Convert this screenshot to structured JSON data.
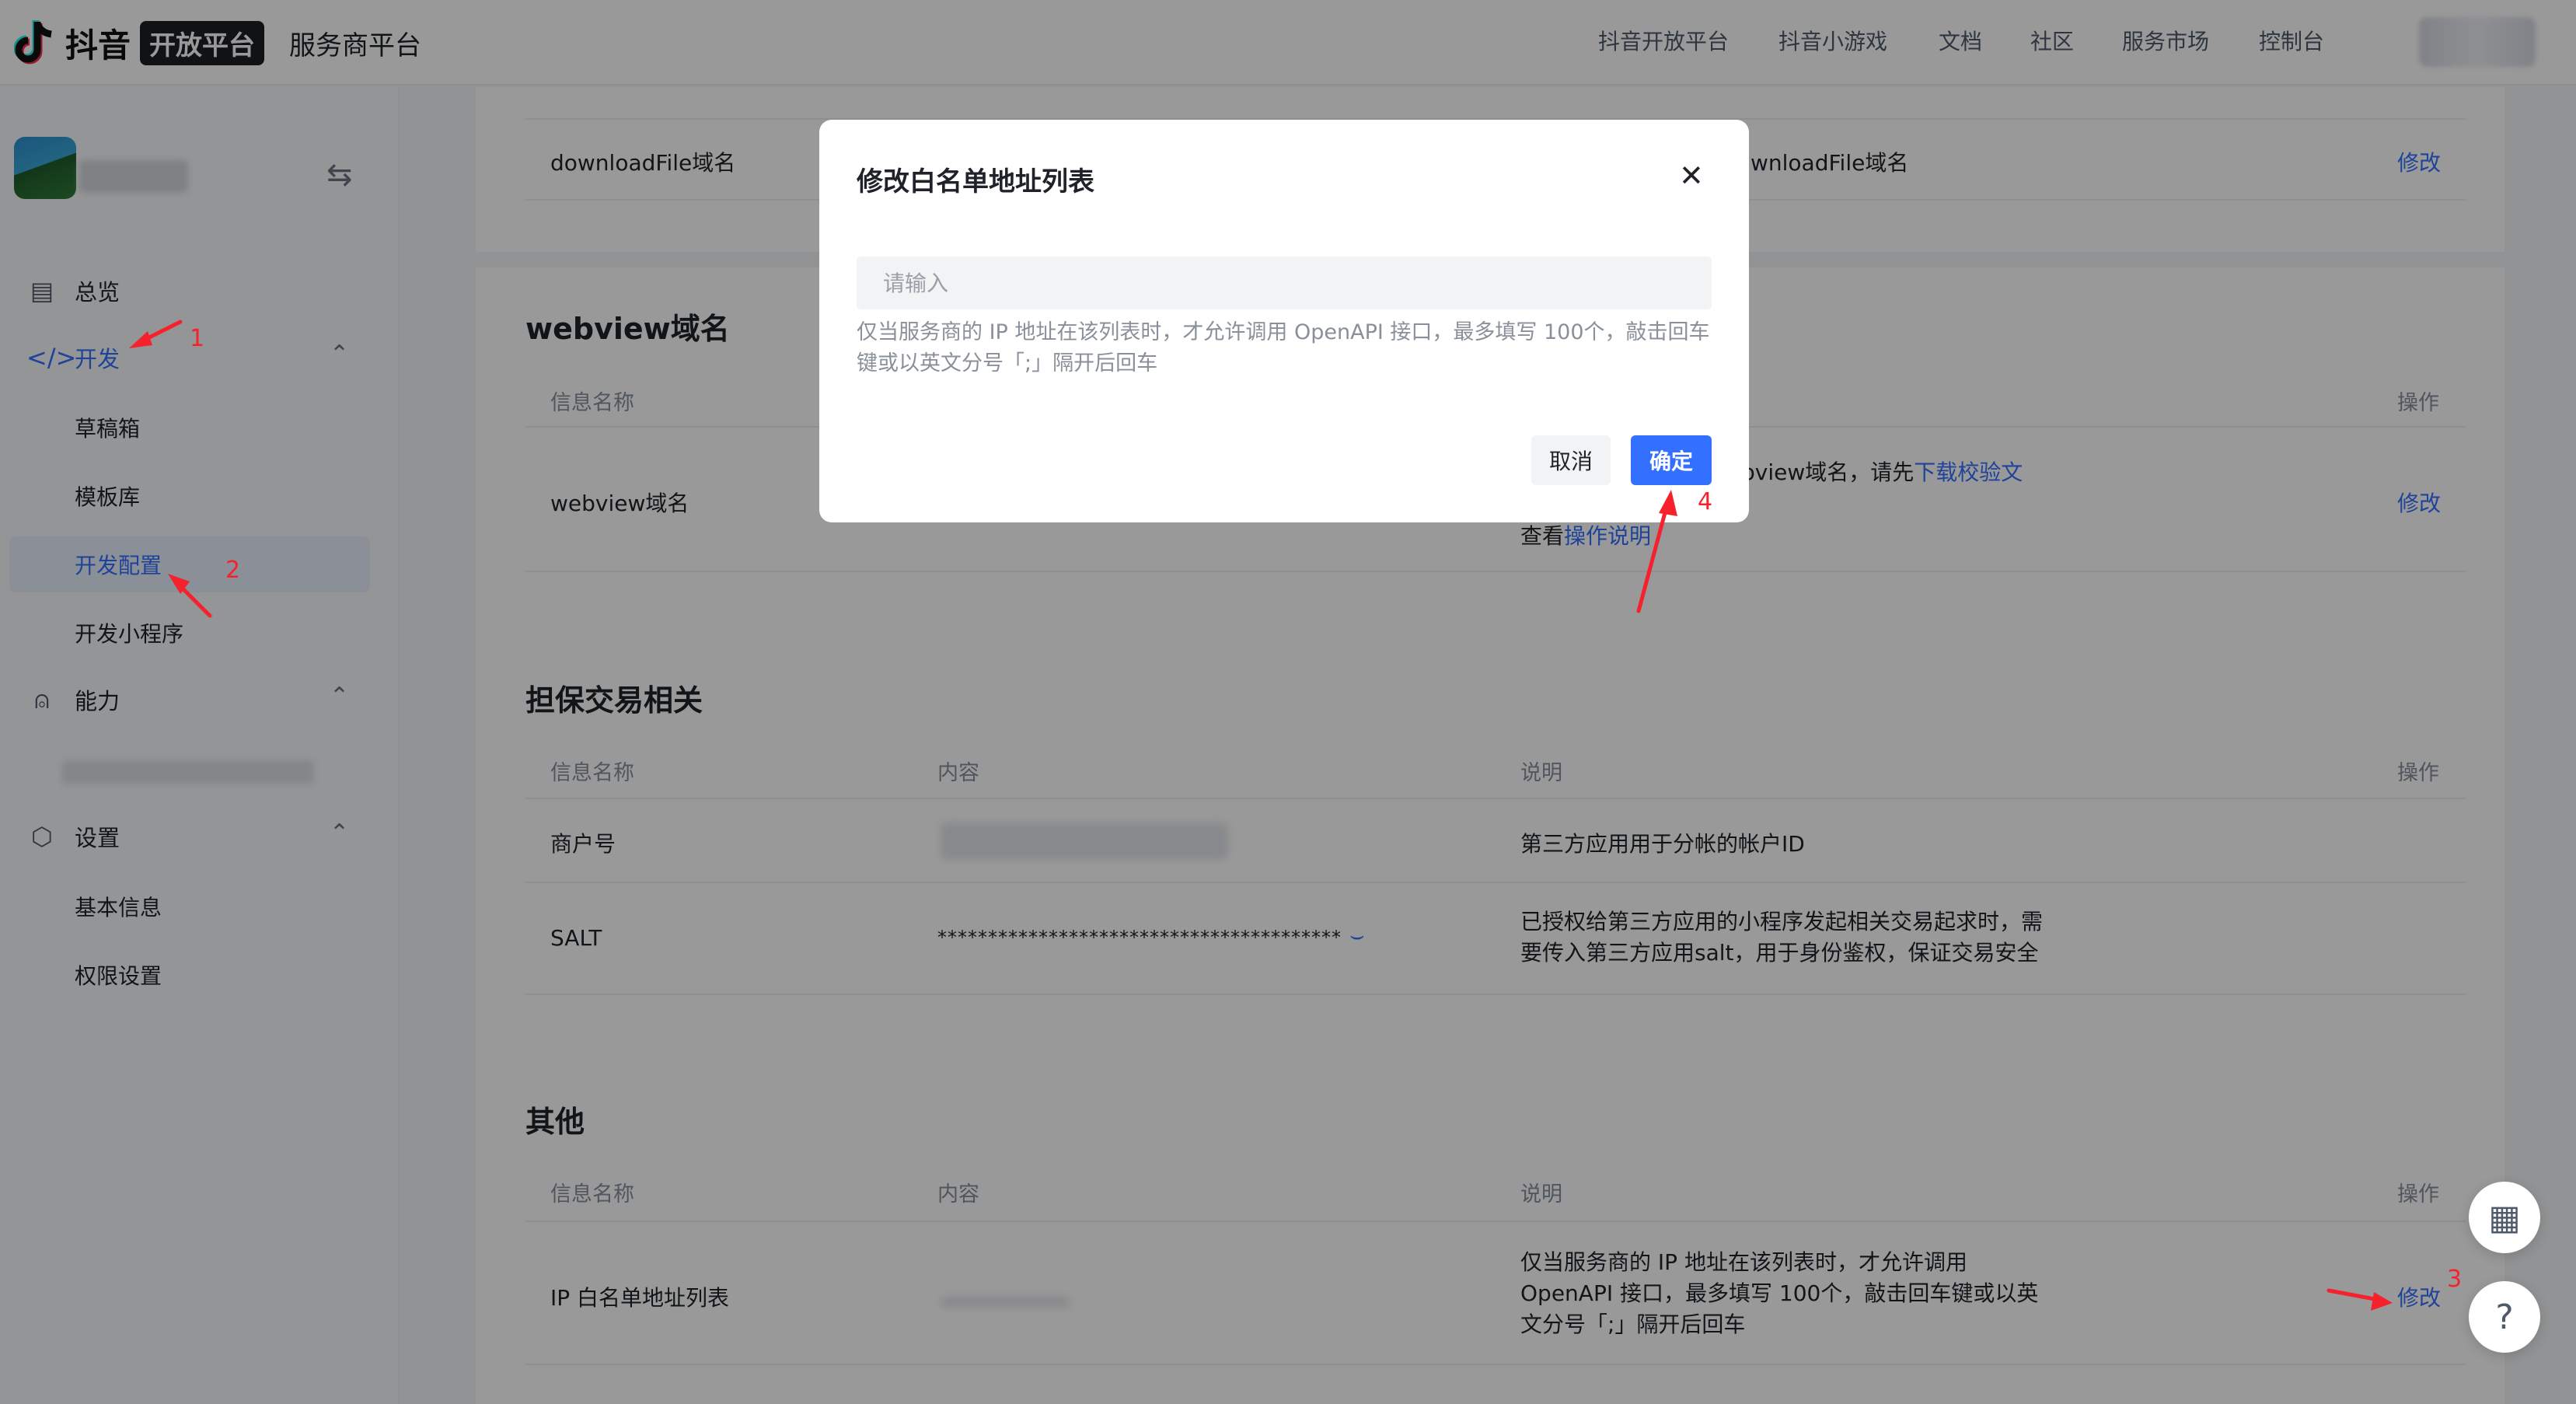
{
  "header": {
    "brand": "抖音",
    "badge": "开放平台",
    "subtitle": "服务商平台",
    "nav": [
      "抖音开放平台",
      "抖音小游戏",
      "文档",
      "社区",
      "服务市场",
      "控制台"
    ]
  },
  "sidebar": {
    "menu": [
      {
        "label": "总览",
        "icon": "dashboard-icon"
      },
      {
        "label": "开发",
        "icon": "code-icon"
      },
      {
        "label": "能力",
        "icon": "bell-icon"
      },
      {
        "label": "设置",
        "icon": "settings-icon"
      }
    ],
    "dev_children": [
      "草稿箱",
      "模板库",
      "开发配置",
      "开发小程序"
    ],
    "settings_children": [
      "基本信息",
      "权限设置"
    ]
  },
  "main": {
    "row_download": {
      "name": "downloadFile域名",
      "desc_fragment": "wnloadFile域名",
      "action": "修改"
    },
    "webview": {
      "title": "webview域名",
      "col_name": "信息名称",
      "col_action": "操作",
      "row_name": "webview域名",
      "desc_prefix": "bview域名，请先",
      "desc_link": "下载校验文",
      "desc2_prefix": "查看",
      "desc2_link": "操作说明",
      "action": "修改"
    },
    "escrow": {
      "title": "担保交易相关",
      "cols": [
        "信息名称",
        "内容",
        "说明",
        "操作"
      ],
      "rows": [
        {
          "name": "商户号",
          "content": "",
          "desc": "第三方应用用于分帐的帐户ID"
        },
        {
          "name": "SALT",
          "content": "****************************************",
          "desc": "已授权给第三方应用的小程序发起相关交易起求时，需要传入第三方应用salt，用于身份鉴权，保证交易安全"
        }
      ]
    },
    "other": {
      "title": "其他",
      "cols": [
        "信息名称",
        "内容",
        "说明",
        "操作"
      ],
      "row": {
        "name": "IP 白名单地址列表",
        "desc": "仅当服务商的 IP 地址在该列表时，才允许调用 OpenAPI 接口，最多填写 100个，敲击回车键或以英文分号「;」隔开后回车",
        "action": "修改"
      }
    }
  },
  "modal": {
    "title": "修改白名单地址列表",
    "input_placeholder": "请输入",
    "hint": "仅当服务商的 IP 地址在该列表时，才允许调用 OpenAPI 接口，最多填写 100个，敲击回车键或以英文分号「;」隔开后回车",
    "cancel": "取消",
    "confirm": "确定"
  },
  "annotations": [
    "1",
    "2",
    "3",
    "4"
  ],
  "colors": {
    "accent": "#3370ff",
    "annotation": "#f5222d"
  }
}
